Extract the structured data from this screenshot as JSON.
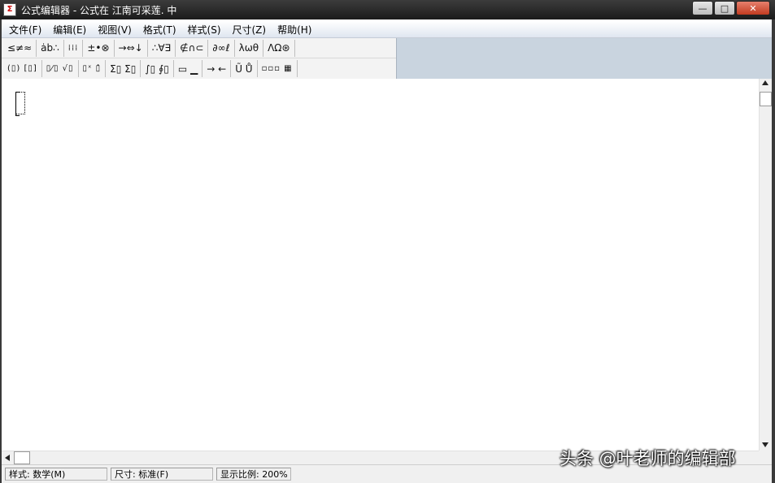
{
  "window": {
    "title": "公式编辑器 - 公式在 江南可采莲. 中",
    "icon_label": "Σ",
    "buttons": {
      "minimize": "—",
      "maximize": "□",
      "close": "✕"
    }
  },
  "menu": [
    {
      "label": "文件(F)"
    },
    {
      "label": "编辑(E)"
    },
    {
      "label": "视图(V)"
    },
    {
      "label": "格式(T)"
    },
    {
      "label": "样式(S)"
    },
    {
      "label": "尺寸(Z)"
    },
    {
      "label": "帮助(H)"
    }
  ],
  "toolbar": {
    "row1": [
      {
        "glyph": "≤≠≈",
        "name": "relational-symbols"
      },
      {
        "glyph": "ȧb∴",
        "name": "spaces-ellipses"
      },
      {
        "glyph": "⁞⁞⁞",
        "name": "embellishments"
      },
      {
        "glyph": "±•⊗",
        "name": "operator-symbols"
      },
      {
        "glyph": "→⇔↓",
        "name": "arrow-symbols"
      },
      {
        "glyph": "∴∀∃",
        "name": "logical-symbols"
      },
      {
        "glyph": "∉∩⊂",
        "name": "set-theory-symbols"
      },
      {
        "glyph": "∂∞ℓ",
        "name": "misc-symbols"
      },
      {
        "glyph": "λωθ",
        "name": "greek-lowercase"
      },
      {
        "glyph": "ΛΩ⊛",
        "name": "greek-uppercase"
      }
    ],
    "row2": [
      {
        "glyph": "(▯) [▯]",
        "name": "fence-templates"
      },
      {
        "glyph": "▯⁄▯ √▯",
        "name": "fraction-radical-templates"
      },
      {
        "glyph": "▯ˣ ▯̂",
        "name": "subscript-superscript-templates"
      },
      {
        "glyph": "Σ▯ Σ▯",
        "name": "summation-templates"
      },
      {
        "glyph": "∫▯ ∮▯",
        "name": "integral-templates"
      },
      {
        "glyph": "▭ ▁",
        "name": "underbar-overbar-templates"
      },
      {
        "glyph": "→ ←",
        "name": "labeled-arrow-templates"
      },
      {
        "glyph": "Ũ Ů",
        "name": "products-set-theory-templates"
      },
      {
        "glyph": "▫▫▫ ▦",
        "name": "matrix-templates"
      }
    ]
  },
  "status": {
    "style": "样式: 数学(M)",
    "size": "尺寸: 标准(F)",
    "zoom": "显示比例: 200%"
  },
  "watermark": "头条 @叶老师的编辑部"
}
